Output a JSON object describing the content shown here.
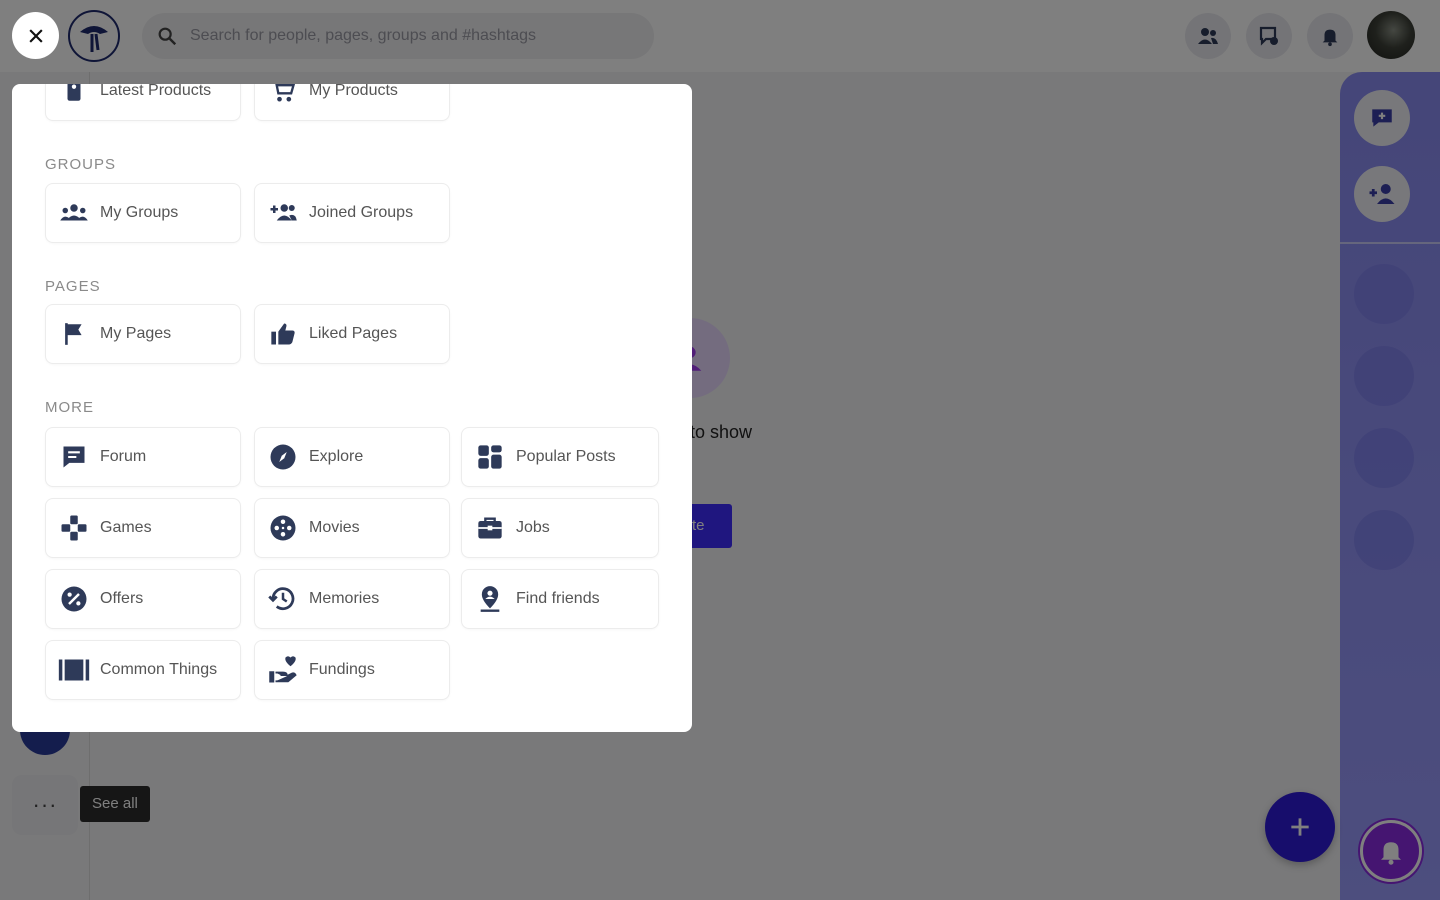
{
  "header": {
    "search_placeholder": "Search for people, pages, groups and #hashtags"
  },
  "content": {
    "empty_text": "to show",
    "empty_button": "te"
  },
  "sidebar": {
    "more_dots": "···",
    "see_all_tooltip": "See all"
  },
  "menu": {
    "marketplace": [
      {
        "label": "Latest Products",
        "icon": "tag-icon"
      },
      {
        "label": "My Products",
        "icon": "cart-icon"
      }
    ],
    "groups_title": "GROUPS",
    "groups": [
      {
        "label": "My Groups",
        "icon": "group-icon"
      },
      {
        "label": "Joined Groups",
        "icon": "group-add-icon"
      }
    ],
    "pages_title": "PAGES",
    "pages": [
      {
        "label": "My Pages",
        "icon": "flag-icon"
      },
      {
        "label": "Liked Pages",
        "icon": "thumbs-up-icon"
      }
    ],
    "more_title": "MORE",
    "more": [
      {
        "label": "Forum",
        "icon": "forum-icon"
      },
      {
        "label": "Explore",
        "icon": "compass-icon"
      },
      {
        "label": "Popular Posts",
        "icon": "grid-icon"
      },
      {
        "label": "Games",
        "icon": "gamepad-icon"
      },
      {
        "label": "Movies",
        "icon": "film-reel-icon"
      },
      {
        "label": "Jobs",
        "icon": "briefcase-icon"
      },
      {
        "label": "Offers",
        "icon": "percent-icon"
      },
      {
        "label": "Memories",
        "icon": "history-icon"
      },
      {
        "label": "Find friends",
        "icon": "location-person-icon"
      },
      {
        "label": "Common Things",
        "icon": "library-icon"
      },
      {
        "label": "Fundings",
        "icon": "hand-heart-icon"
      }
    ]
  },
  "colors": {
    "accent": "#3f2cff",
    "panel": "#9a9cfd",
    "fab": "#2f1bd8",
    "icon": "#2e3a59"
  }
}
